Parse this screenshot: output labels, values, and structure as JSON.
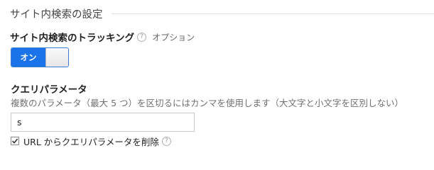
{
  "section": {
    "title": "サイト内検索の設定"
  },
  "tracking": {
    "label": "サイト内検索のトラッキング",
    "help_glyph": "?",
    "optional_text": "オプション",
    "toggle_on_label": "オン",
    "toggle_state": "on"
  },
  "query_param": {
    "label": "クエリパラメータ",
    "description": "複数のパラメータ（最大 5 つ）を区切るにはカンマを使用します（大文字と小文字を区別しない）",
    "input_value": "s",
    "remove_checkbox_checked": true,
    "remove_checkbox_label": "URL からクエリパラメータを削除",
    "help_glyph": "?"
  },
  "colors": {
    "toggle_accent": "#1a73e8",
    "divider": "#e0e0e0"
  }
}
